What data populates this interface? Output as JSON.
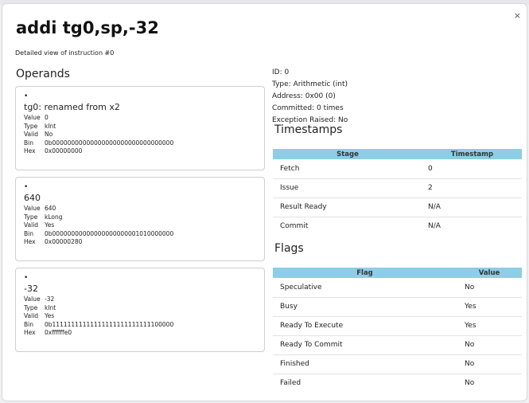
{
  "modal": {
    "close_label": "×",
    "title": "addi tg0,sp,-32",
    "subtitle": "Detailed view of instruction #0"
  },
  "operands": {
    "heading": "Operands",
    "bullet": "•",
    "labels": {
      "value": "Value",
      "type": "Type",
      "valid": "Valid",
      "bin": "Bin",
      "hex": "Hex"
    },
    "items": [
      {
        "title": "tg0: renamed from x2",
        "value": "0",
        "type": "kInt",
        "valid": "No",
        "bin": "0b00000000000000000000000000000000",
        "hex": "0x00000000"
      },
      {
        "title": "640",
        "value": "640",
        "type": "kLong",
        "valid": "Yes",
        "bin": "0b00000000000000000000001010000000",
        "hex": "0x00000280"
      },
      {
        "title": "-32",
        "value": "-32",
        "type": "kInt",
        "valid": "Yes",
        "bin": "0b11111111111111111111111111100000",
        "hex": "0xffffffe0"
      }
    ]
  },
  "info": {
    "id": "ID: 0",
    "type": "Type: Arithmetic (int)",
    "address": "Address: 0x00 (0)",
    "committed": "Committed: 0 times",
    "exception": "Exception Raised: No"
  },
  "timestamps": {
    "heading": "Timestamps",
    "col_stage": "Stage",
    "col_timestamp": "Timestamp",
    "rows": [
      {
        "stage": "Fetch",
        "timestamp": "0"
      },
      {
        "stage": "Issue",
        "timestamp": "2"
      },
      {
        "stage": "Result Ready",
        "timestamp": "N/A"
      },
      {
        "stage": "Commit",
        "timestamp": "N/A"
      }
    ]
  },
  "flags": {
    "heading": "Flags",
    "col_flag": "Flag",
    "col_value": "Value",
    "rows": [
      {
        "flag": "Speculative",
        "value": "No"
      },
      {
        "flag": "Busy",
        "value": "Yes"
      },
      {
        "flag": "Ready To Execute",
        "value": "Yes"
      },
      {
        "flag": "Ready To Commit",
        "value": "No"
      },
      {
        "flag": "Finished",
        "value": "No"
      },
      {
        "flag": "Failed",
        "value": "No"
      }
    ]
  },
  "colors": {
    "table_header": "#8ecde6",
    "card_border": "#cfcfcf"
  }
}
